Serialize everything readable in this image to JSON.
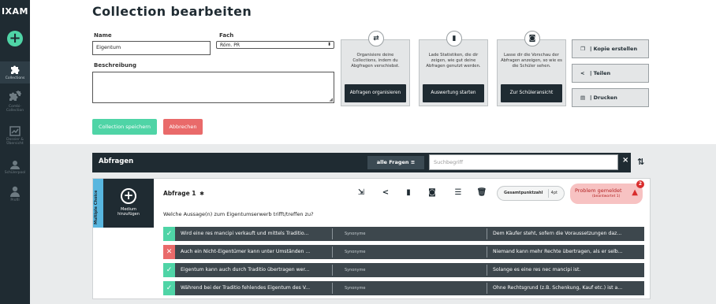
{
  "sidebar": {
    "logo": "IXAM",
    "items": [
      {
        "label": "Collections",
        "active": true
      },
      {
        "label": "Combi-Collection",
        "active": false
      },
      {
        "label": "Dossier & Übersicht",
        "active": false
      },
      {
        "label": "Schülerpool",
        "active": false
      },
      {
        "label": "Profil",
        "active": false
      }
    ]
  },
  "header": {
    "title": "Collection bearbeiten"
  },
  "form": {
    "name_label": "Name",
    "name_value": "Eigentum",
    "subject_label": "Fach",
    "subject_value": "Röm. PR",
    "description_label": "Beschreibung",
    "save_label": "Collection speichern",
    "cancel_label": "Abbrechen"
  },
  "cards": [
    {
      "icon": "move-icon",
      "desc": "Organisiere deine Collections, indem du Abgfragen verschiebst.",
      "button": "Abfragen organisieren"
    },
    {
      "icon": "stats-icon",
      "desc": "Lade Statistiken, die dir zeigen, wie gut deine Abfragen genutzt werden.",
      "button": "Auswertung starten"
    },
    {
      "icon": "camera-icon",
      "desc": "Lasse dir die Vorschau der Abfragen anzeigen, so wie es die Schüler sehen.",
      "button": "Zur Schüleransicht"
    }
  ],
  "actions": {
    "copy": "| Kopie erstellen",
    "share": "| Teilen",
    "print": "| Drucken"
  },
  "questions_bar": {
    "title": "Abfragen",
    "filter": "alle Fragen",
    "search_placeholder": "Suchbegriff",
    "clear": "×"
  },
  "question": {
    "type": "Multiple Choice",
    "media_label_1": "Medium",
    "media_label_2": "hinzufügen",
    "name": "Abfrage 1",
    "text": "Welche Aussage(n) zum Eigentumserwerb trifft/treffen zu?",
    "points_label": "Gesamtpunktzahl",
    "points_value": "4pt",
    "problem_title": "Problem gemeldet",
    "problem_sub": "(beantwortet 1)",
    "problem_count": "2",
    "answers": [
      {
        "correct": true,
        "text": "Wird eine res mancipi verkauft und mittels Traditio...",
        "synonyms": "Synonyme",
        "explanation": "Dem Käufer steht, sofern die Voraussetzungen daz..."
      },
      {
        "correct": false,
        "text": "Auch ein Nicht-Eigentümer kann unter Umständen ...",
        "synonyms": "Synonyme",
        "explanation": "Niemand kann mehr Rechte übertragen, als er selb..."
      },
      {
        "correct": true,
        "text": "Eigentum kann auch durch Traditio übertragen wer...",
        "synonyms": "Synonyme",
        "explanation": "Solange es eine res nec mancipi ist."
      },
      {
        "correct": true,
        "text": "Während bei der Traditio fehlendes Eigentum des V...",
        "synonyms": "Synonyme",
        "explanation": "Ohne Rechtsgrund (z.B. Schenkung, Kauf etc.) ist a..."
      }
    ]
  },
  "colors": {
    "dark": "#1f2b32",
    "accent": "#4fd4a6",
    "danger": "#e96a6a",
    "type_strip": "#58b6df"
  }
}
